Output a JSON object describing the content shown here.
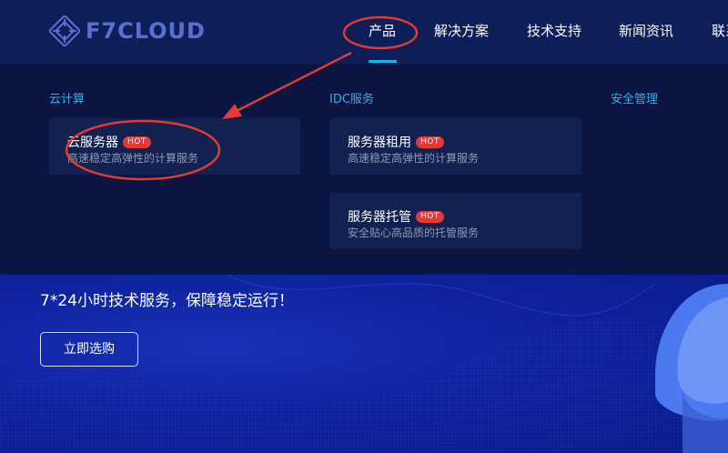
{
  "logo": {
    "text": "F7CLOUD"
  },
  "nav": {
    "items": [
      {
        "label": "产品",
        "active": true
      },
      {
        "label": "解决方案"
      },
      {
        "label": "技术支持"
      },
      {
        "label": "新闻资讯"
      },
      {
        "label": "联系"
      }
    ]
  },
  "dropdown": {
    "columns": [
      {
        "title": "云计算",
        "cards": [
          {
            "title": "云服务器",
            "badge": "HOT",
            "desc": "高速稳定高弹性的计算服务"
          }
        ]
      },
      {
        "title": "IDC服务",
        "cards": [
          {
            "title": "服务器租用",
            "badge": "HOT",
            "desc": "高速稳定高弹性的计算服务"
          },
          {
            "title": "服务器托管",
            "badge": "HOT",
            "desc": "安全贴心高品质的托管服务"
          }
        ]
      },
      {
        "title": "安全管理",
        "cards": []
      }
    ]
  },
  "hero": {
    "tagline": "7*24小时技术服务，保障稳定运行！",
    "cta_label": "立即选购"
  },
  "colors": {
    "header_bg": "#0d1e58",
    "dropdown_bg": "#0a1541",
    "card_bg": "#12214f",
    "accent": "#2eb0e8",
    "badge": "#e03a3a",
    "annotation": "#e53935",
    "hero_bg": "#0f23a0"
  }
}
